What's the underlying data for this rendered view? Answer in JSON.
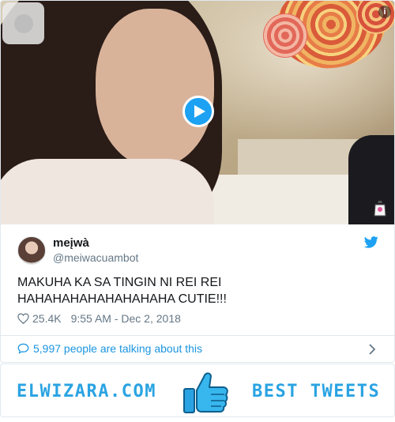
{
  "media": {
    "icons": {
      "corner": "gray-rounded-button",
      "info": "info-icon",
      "play": "play-icon",
      "watermark": "sticker-icon"
    },
    "info_glyph": "i"
  },
  "tweet": {
    "display_name": "meįwà",
    "handle": "@meiwacuambot",
    "text_line1": "MAKUHA KA SA TINGIN NI REI REI",
    "text_line2": "HAHAHAHAHAHAHAHAHA CUTIE!!!",
    "likes": "25.4K",
    "timestamp": "9:55 AM - Dec 2, 2018",
    "talking": "5,997 people are talking about this",
    "icons": {
      "brand": "twitter-bird-icon",
      "like": "heart-icon",
      "reply": "speech-bubble-icon",
      "more": "chevron-right-icon"
    }
  },
  "banner": {
    "left_text": "ELWIZARA.COM",
    "right_text": "BEST TWEETS",
    "icon": "thumbs-up-icon"
  },
  "colors": {
    "accent": "#1da1f2",
    "link": "#1b95e0",
    "muted": "#657786",
    "banner_text": "#2aa3e2"
  }
}
